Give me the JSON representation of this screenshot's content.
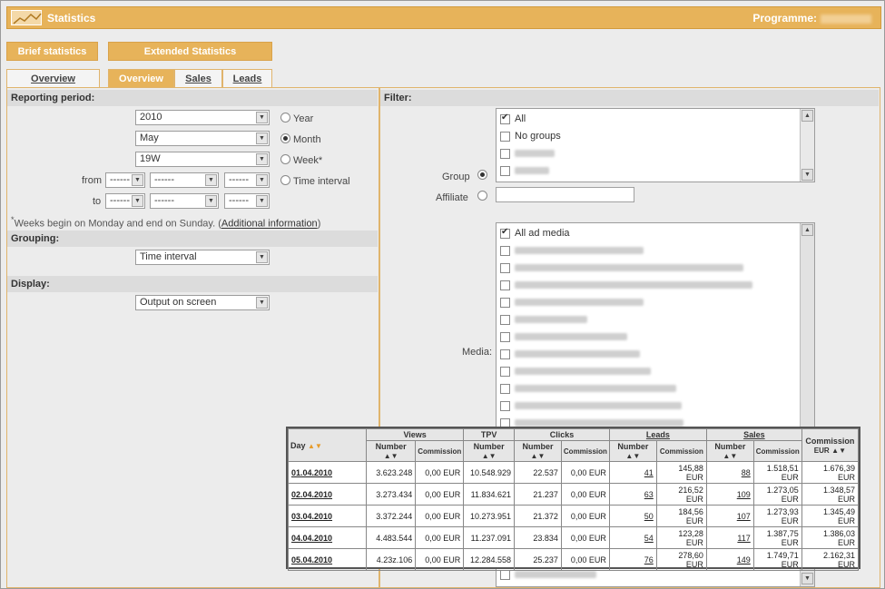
{
  "header": {
    "title": "Statistics",
    "programme_label": "Programme:"
  },
  "top_buttons": {
    "brief": "Brief statistics",
    "extended": "Extended Statistics"
  },
  "tabs": {
    "left": "Overview",
    "overview": "Overview",
    "sales": "Sales",
    "leads": "Leads"
  },
  "reporting": {
    "section": "Reporting period:",
    "year_value": "2010",
    "year_label": "Year",
    "month_value": "May",
    "month_label": "Month",
    "week_value": "19W",
    "week_label": "Week*",
    "time_label": "Time interval",
    "from_label": "from",
    "to_label": "to",
    "placeholder": "------",
    "note_star": "*",
    "note": "Weeks begin on Monday and end on Sunday. (",
    "note_link": "Additional information",
    "note_end": ")"
  },
  "grouping": {
    "section": "Grouping:",
    "value": "Time interval"
  },
  "display": {
    "section": "Display:",
    "value": "Output on screen"
  },
  "filter": {
    "section": "Filter:",
    "group_label": "Group",
    "affiliate_label": "Affiliate",
    "media_label": "Media:",
    "group_items": [
      "All",
      "No groups"
    ],
    "media_first": "All ad media"
  },
  "table": {
    "day_header": "Day",
    "views": "Views",
    "tpv": "TPV",
    "clicks": "Clicks",
    "leads": "Leads",
    "sales": "Sales",
    "commission_total": "Commission",
    "eur": "EUR",
    "number": "Number",
    "commission": "Commission",
    "rows": [
      {
        "day": "01.04.2010",
        "views_n": "3.623.248",
        "views_c": "0,00 EUR",
        "tpv": "10.548.929",
        "clicks_n": "22.537",
        "clicks_c": "0,00 EUR",
        "leads_n": "41",
        "leads_c": "145,88 EUR",
        "sales_n": "88",
        "sales_c1": "1.518,51",
        "sales_c2": "EUR",
        "total": "1.676,39 EUR"
      },
      {
        "day": "02.04.2010",
        "views_n": "3.273.434",
        "views_c": "0,00 EUR",
        "tpv": "11.834.621",
        "clicks_n": "21.237",
        "clicks_c": "0,00 EUR",
        "leads_n": "63",
        "leads_c": "216,52 EUR",
        "sales_n": "109",
        "sales_c1": "1.273,05",
        "sales_c2": "EUR",
        "total": "1.348,57 EUR"
      },
      {
        "day": "03.04.2010",
        "views_n": "3.372.244",
        "views_c": "0,00 EUR",
        "tpv": "10.273.951",
        "clicks_n": "21.372",
        "clicks_c": "0,00 EUR",
        "leads_n": "50",
        "leads_c": "184,56 EUR",
        "sales_n": "107",
        "sales_c1": "1.273,93",
        "sales_c2": "EUR",
        "total": "1.345,49 EUR"
      },
      {
        "day": "04.04.2010",
        "views_n": "4.483.544",
        "views_c": "0,00 EUR",
        "tpv": "11.237.091",
        "clicks_n": "23.834",
        "clicks_c": "0,00 EUR",
        "leads_n": "54",
        "leads_c": "123,28 EUR",
        "sales_n": "117",
        "sales_c1": "1.387,75",
        "sales_c2": "EUR",
        "total": "1.386,03 EUR"
      },
      {
        "day": "05.04.2010",
        "views_n": "4.23z.106",
        "views_c": "0,00 EUR",
        "tpv": "12.284.558",
        "clicks_n": "25.237",
        "clicks_c": "0,00 EUR",
        "leads_n": "76",
        "leads_c": "278,60 EUR",
        "sales_n": "149",
        "sales_c1": "1.749,71",
        "sales_c2": "EUR",
        "total": "2.162,31 EUR"
      }
    ]
  }
}
